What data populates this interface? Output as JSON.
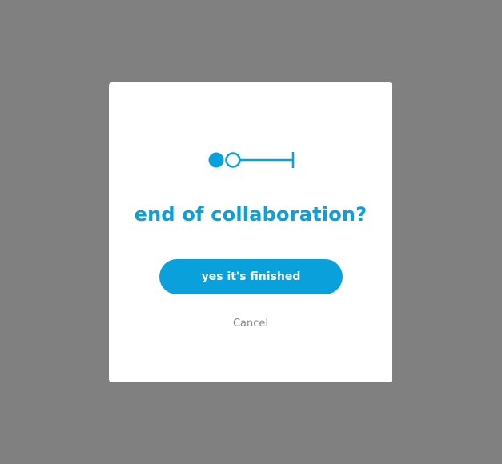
{
  "colors": {
    "backdrop": "#808080",
    "accent": "#0aa0dc",
    "dialog_background": "#ffffff",
    "cancel_text": "#8a8a8a"
  },
  "dialog": {
    "icon": "end-of-collaboration-icon",
    "title": "end of collaboration?",
    "confirm_label": "yes it's finished",
    "cancel_label": "Cancel"
  }
}
